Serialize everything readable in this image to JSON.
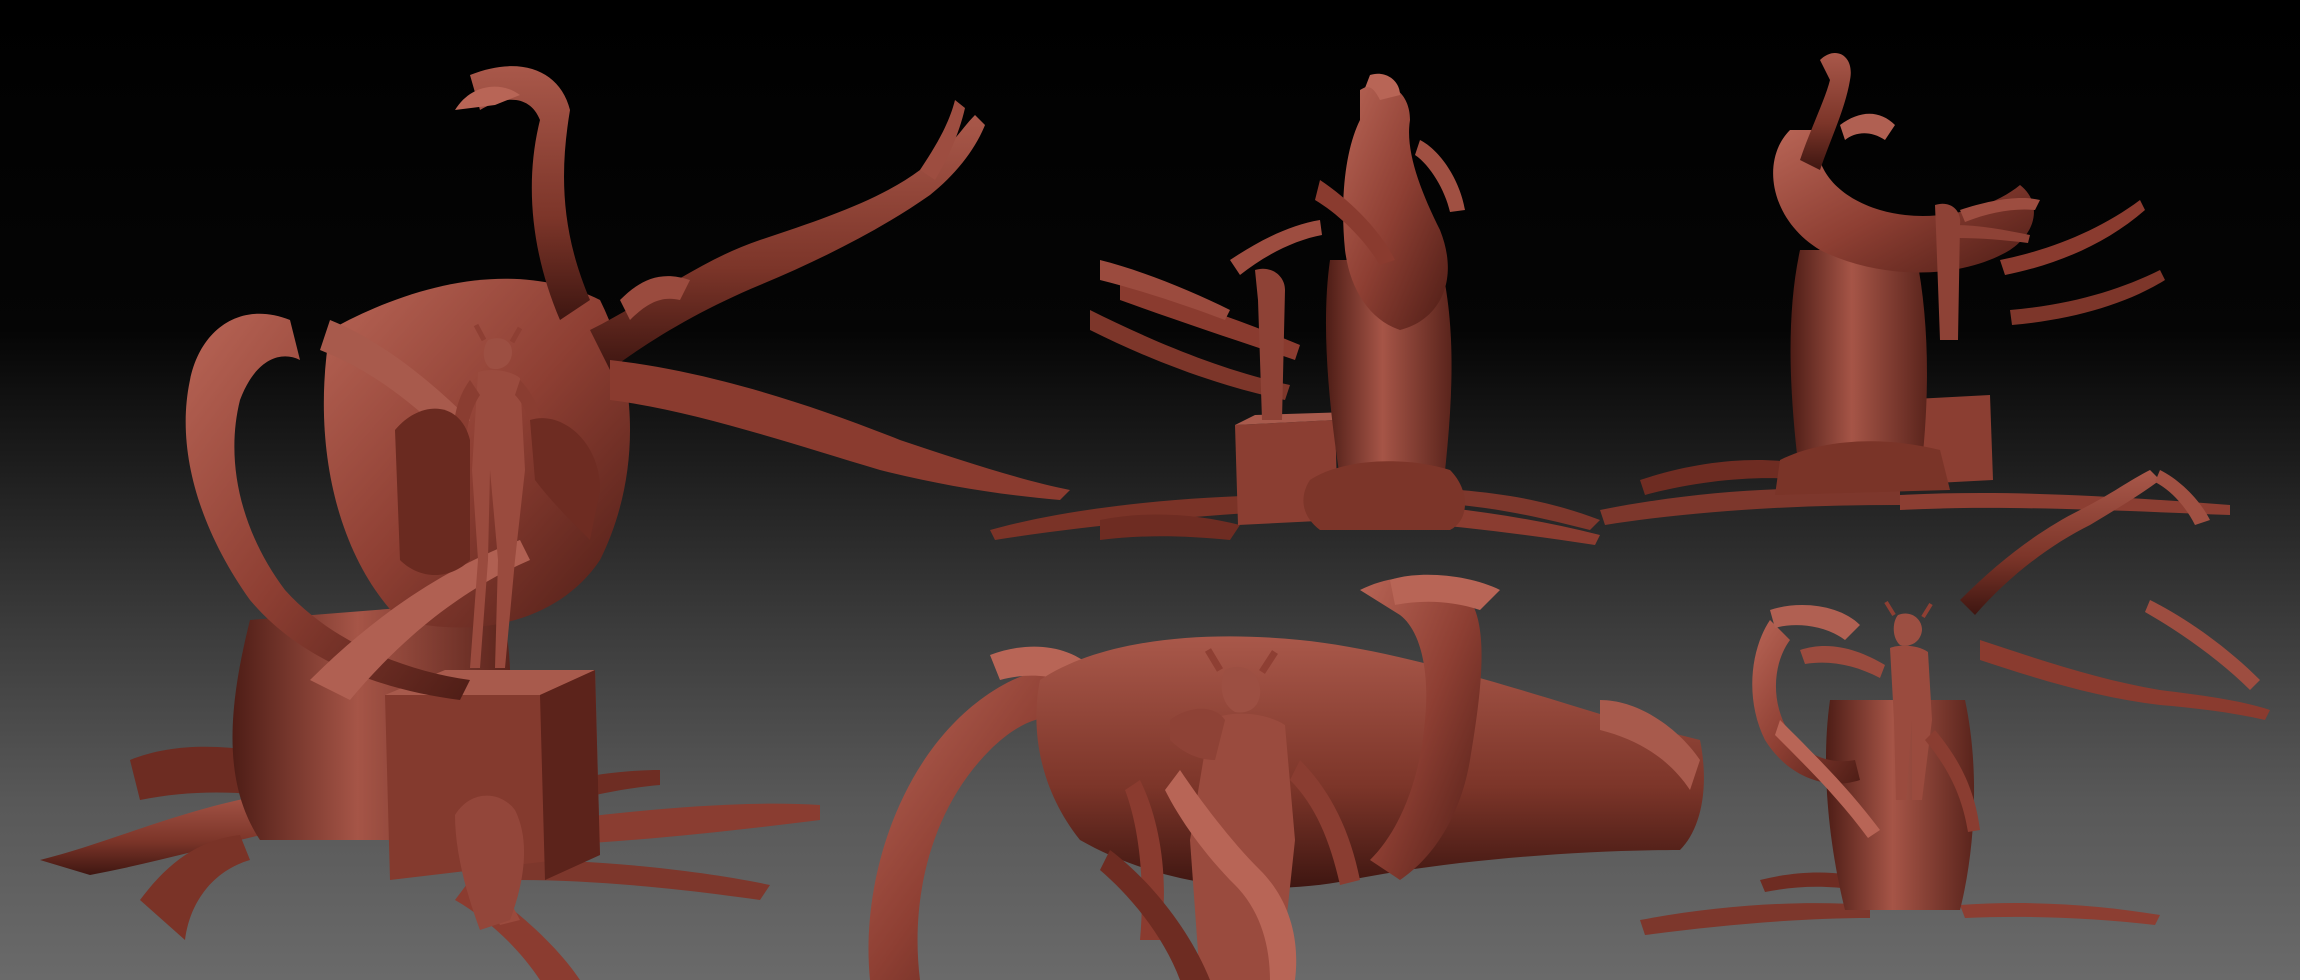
{
  "scene": {
    "kind": "sculpt-turnaround",
    "material_colors": {
      "base": "#8e3f33",
      "light": "#b86556",
      "shadow": "#4e1d16",
      "deep": "#2f100c"
    },
    "background_colors": {
      "top": "#000000",
      "bottom": "#6a6a6a"
    },
    "views": [
      {
        "id": "main-perspective"
      },
      {
        "id": "side-view"
      },
      {
        "id": "back-view"
      },
      {
        "id": "closeup-front"
      },
      {
        "id": "small-front"
      }
    ]
  }
}
